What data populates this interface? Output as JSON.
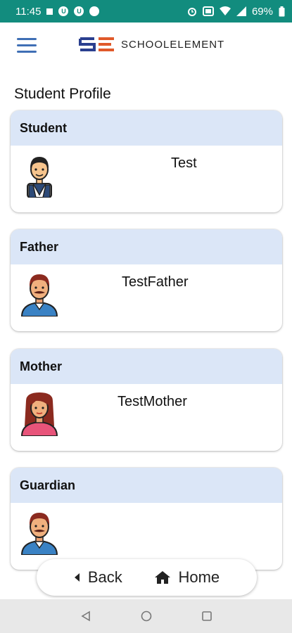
{
  "status": {
    "time": "11:45",
    "battery": "69%"
  },
  "app": {
    "brand": "SCHOOLELEMENT"
  },
  "page": {
    "title": "Student Profile"
  },
  "cards": [
    {
      "header": "Student",
      "name": "Test"
    },
    {
      "header": "Father",
      "name": "TestFather"
    },
    {
      "header": "Mother",
      "name": "TestMother"
    },
    {
      "header": "Guardian",
      "name": ""
    }
  ],
  "nav": {
    "back_label": "Back",
    "home_label": "Home"
  },
  "colors": {
    "status_bar": "#128c7e",
    "card_header": "#dbe6f7",
    "accent": "#3f6fb5"
  }
}
